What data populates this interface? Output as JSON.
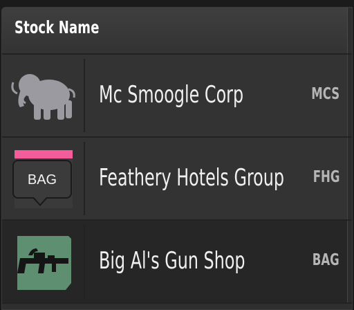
{
  "table": {
    "header": {
      "stock_name": "Stock Name"
    },
    "rows": [
      {
        "name": "Mc Smoogle Corp",
        "ticker": "MCS",
        "logo": "mammoth-icon"
      },
      {
        "name": "Feathery Hotels Group",
        "ticker": "FHG",
        "logo": "pink-logo-icon"
      },
      {
        "name": "Big Al's Gun Shop",
        "ticker": "BAG",
        "logo": "rifle-icon"
      }
    ]
  },
  "tooltip": {
    "text": "BAG"
  },
  "colors": {
    "pink_logo": "#f45c9a",
    "rifle_logo_bg": "#5d8f70"
  }
}
